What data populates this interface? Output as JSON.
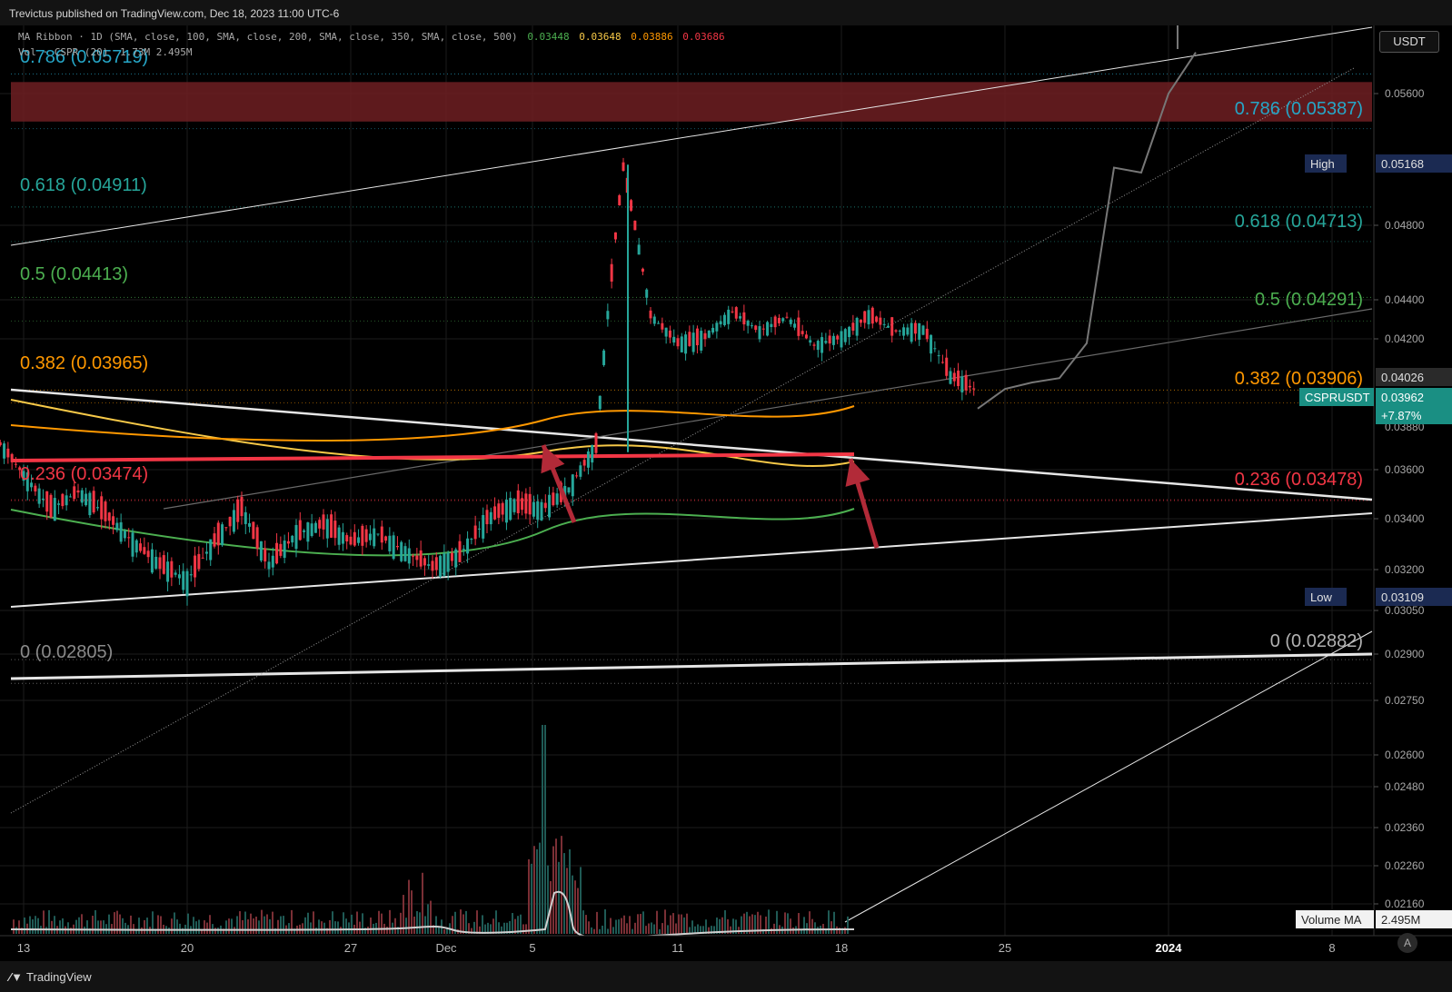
{
  "header": {
    "publish_text": "Trevictus published on TradingView.com, Dec 18, 2023 11:00 UTC-6"
  },
  "legend": {
    "ma_ribbon_label": "MA Ribbon · 1D (SMA, close, 100, SMA, close, 200, SMA, close, 350, SMA, close, 500)",
    "ma_values": [
      "0.03448",
      "0.03648",
      "0.03886",
      "0.03686"
    ],
    "ma_colors": [
      "#4caf50",
      "#f7c948",
      "#ff9800",
      "#f23645"
    ],
    "vol_label": "Vol · CSPR (20)",
    "vol_values": "1.73M  2.495M"
  },
  "currency_button": "USDT",
  "branding": "TradingView",
  "auto_button": "A",
  "chart_data": {
    "type": "candlestick",
    "symbol": "CSPRUSDT",
    "last_price": "0.03962",
    "change": "+7.87%",
    "prev_close_tag": "0.04026",
    "high_label": "High",
    "high_value": "0.05168",
    "low_label": "Low",
    "low_value": "0.03109",
    "volume_ma_label": "Volume MA",
    "volume_ma_value": "2.495M",
    "y_ticks": [
      "0.05600",
      "0.04800",
      "0.04400",
      "0.04200",
      "0.03600",
      "0.03400",
      "0.03200",
      "0.03050",
      "0.02900",
      "0.02750",
      "0.02600",
      "0.02480",
      "0.02360",
      "0.02260",
      "0.02160"
    ],
    "y_tick_partial": "0.03880",
    "x_ticks": [
      "13",
      "20",
      "27",
      "Dec",
      "5",
      "11",
      "18",
      "25",
      "2024",
      "8"
    ],
    "x_bold_tick": "2024",
    "fib_left": [
      {
        "text": "0.786 (0.05719)",
        "price": 0.05719,
        "color": "#26a6c7"
      },
      {
        "text": "0.618 (0.04911)",
        "price": 0.04911,
        "color": "#26a69a"
      },
      {
        "text": "0.5 (0.04413)",
        "price": 0.04413,
        "color": "#4caf50"
      },
      {
        "text": "0.382 (0.03965)",
        "price": 0.03965,
        "color": "#ff9800"
      },
      {
        "text": "0.236 (0.03474)",
        "price": 0.03474,
        "color": "#f23645"
      },
      {
        "text": "0 (0.02805)",
        "price": 0.02805,
        "color": "#8a8a8a"
      }
    ],
    "fib_right": [
      {
        "text": "0.786 (0.05387)",
        "price": 0.05387,
        "color": "#26a6c7"
      },
      {
        "text": "0.618 (0.04713)",
        "price": 0.04713,
        "color": "#26a69a"
      },
      {
        "text": "0.5 (0.04291)",
        "price": 0.04291,
        "color": "#4caf50"
      },
      {
        "text": "0.382 (0.03906)",
        "price": 0.03906,
        "color": "#ff9800"
      },
      {
        "text": "0.236 (0.03478)",
        "price": 0.03478,
        "color": "#f23645"
      },
      {
        "text": "0 (0.02882)",
        "price": 0.02882,
        "color": "#b2b2b2"
      }
    ],
    "price_path": [
      [
        "Nov 11",
        0.0382
      ],
      [
        "Nov 12",
        0.0374
      ],
      [
        "Nov 13",
        0.0358
      ],
      [
        "Nov 14",
        0.0344
      ],
      [
        "Nov 15",
        0.0351
      ],
      [
        "Nov 16",
        0.0342
      ],
      [
        "Nov 17",
        0.0331
      ],
      [
        "Nov 18",
        0.0322
      ],
      [
        "Nov 19",
        0.0316
      ],
      [
        "Nov 20",
        0.0331
      ],
      [
        "Nov 21",
        0.0344
      ],
      [
        "Nov 22",
        0.0322
      ],
      [
        "Nov 23",
        0.0334
      ],
      [
        "Nov 24",
        0.0338
      ],
      [
        "Nov 25",
        0.0331
      ],
      [
        "Nov 26",
        0.0334
      ],
      [
        "Nov 27",
        0.0327
      ],
      [
        "Nov 28",
        0.0321
      ],
      [
        "Nov 29",
        0.0326
      ],
      [
        "Nov 30",
        0.034
      ],
      [
        "Dec 1",
        0.0346
      ],
      [
        "Dec 2",
        0.0344
      ],
      [
        "Dec 3",
        0.0352
      ],
      [
        "Dec 4",
        0.0371
      ],
      [
        "Dec 5",
        0.0515
      ],
      [
        "Dec 6",
        0.0432
      ],
      [
        "Dec 7",
        0.0418
      ],
      [
        "Dec 8",
        0.0421
      ],
      [
        "Dec 9",
        0.0434
      ],
      [
        "Dec 10",
        0.0424
      ],
      [
        "Dec 11",
        0.0431
      ],
      [
        "Dec 12",
        0.0417
      ],
      [
        "Dec 13",
        0.0421
      ],
      [
        "Dec 14",
        0.0432
      ],
      [
        "Dec 15",
        0.0424
      ],
      [
        "Dec 16",
        0.0425
      ],
      [
        "Dec 17",
        0.0403
      ],
      [
        "Dec 18",
        0.0396
      ]
    ],
    "projection_path": [
      [
        "Dec 18",
        0.0388
      ],
      [
        "Dec 19",
        0.0397
      ],
      [
        "Dec 20",
        0.04
      ],
      [
        "Dec 21",
        0.0402
      ],
      [
        "Dec 22",
        0.0418
      ],
      [
        "Dec 23",
        0.0515
      ],
      [
        "Dec 24",
        0.0512
      ],
      [
        "Dec 25",
        0.056
      ],
      [
        "Dec 26",
        0.0585
      ]
    ],
    "ma_lines": [
      {
        "name": "SMA 100",
        "color": "#4caf50"
      },
      {
        "name": "SMA 200",
        "color": "#f7c948"
      },
      {
        "name": "SMA 350",
        "color": "#ff9800"
      },
      {
        "name": "SMA 500",
        "color": "#f23645"
      }
    ],
    "resistance_zone": [
      0.0543,
      0.0567
    ],
    "grid": true
  }
}
